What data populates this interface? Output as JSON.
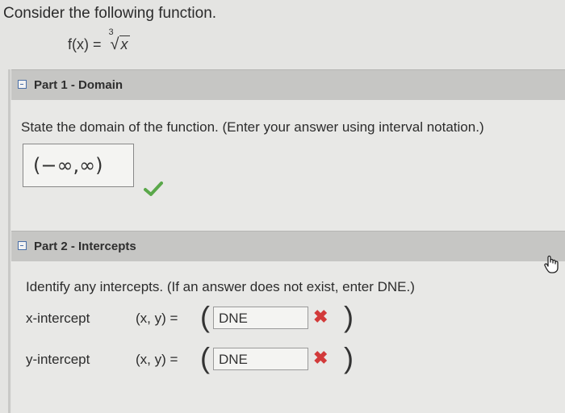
{
  "question": {
    "intro": "Consider the following function.",
    "function": {
      "lhs": "f(x) =",
      "root_index": "3",
      "radical": "√",
      "radicand": "x"
    }
  },
  "part1": {
    "header": "Part 1 - Domain",
    "prompt": "State the domain of the function. (Enter your answer using interval notation.)",
    "answer": "(−∞,∞)",
    "status": "correct"
  },
  "part2": {
    "header": "Part 2 - Intercepts",
    "prompt": "Identify any intercepts. (If an answer does not exist, enter DNE.)",
    "rows": [
      {
        "label": "x-intercept",
        "expr": "(x, y) =",
        "value": "DNE",
        "status": "incorrect"
      },
      {
        "label": "y-intercept",
        "expr": "(x, y) =",
        "value": "DNE",
        "status": "incorrect"
      }
    ]
  },
  "symbols": {
    "open_paren": "(",
    "close_paren": ")",
    "incorrect_mark": "✖"
  },
  "colors": {
    "correct": "#5aa84a",
    "incorrect": "#d23a3a",
    "header_bg": "#c6c6c4",
    "toggle": "#4a6fa8"
  }
}
